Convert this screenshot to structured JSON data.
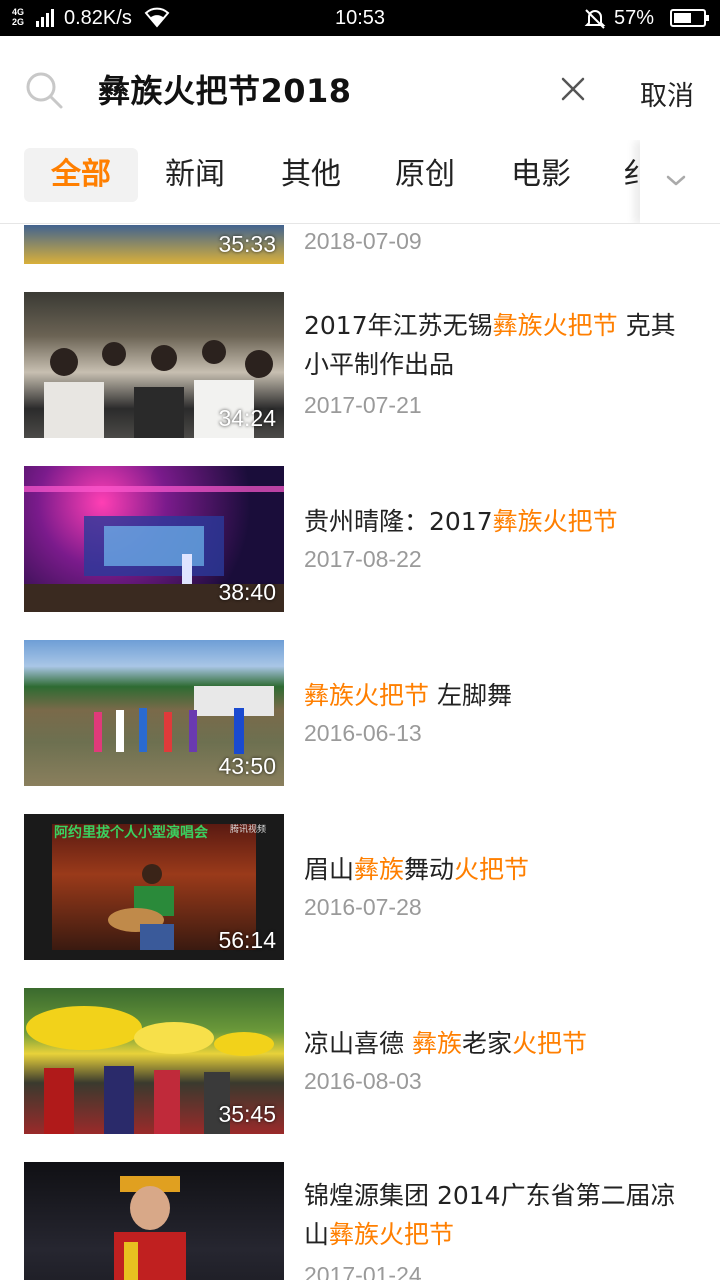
{
  "status_bar": {
    "network": "4G 2G",
    "speed": "0.82K/s",
    "time": "10:53",
    "battery_pct": "57%"
  },
  "search": {
    "query": "彝族火把节2018",
    "cancel_label": "取消"
  },
  "tabs": [
    "全部",
    "新闻",
    "其他",
    "原创",
    "电影",
    "纟"
  ],
  "accent_color": "#ff7f00",
  "results": [
    {
      "title_parts": [],
      "date": "2018-07-09",
      "duration": "35:33"
    },
    {
      "title_parts": [
        "2017年江苏无锡",
        "彝族火把节",
        " 克其小平制作出品"
      ],
      "date": "2017-07-21",
      "duration": "34:24"
    },
    {
      "title_parts": [
        "贵州晴隆：2017",
        "彝族火把节",
        ""
      ],
      "date": "2017-08-22",
      "duration": "38:40"
    },
    {
      "title_parts": [
        "",
        "彝族火把节",
        " 左脚舞"
      ],
      "date": "2016-06-13",
      "duration": "43:50"
    },
    {
      "title_parts": [
        "眉山",
        "彝族",
        "舞动",
        "火把节",
        ""
      ],
      "date": "2016-07-28",
      "duration": "56:14"
    },
    {
      "title_parts": [
        "凉山喜德 ",
        "彝族",
        "老家",
        "火把节",
        ""
      ],
      "date": "2016-08-03",
      "duration": "35:45"
    },
    {
      "title_parts": [
        "锦煌源集团 2014广东省第二届凉山",
        "彝族火把节",
        ""
      ],
      "date": "2017-01-24",
      "duration": ""
    }
  ],
  "thumb_overlay_texts": {
    "thumb4_banner": "阿约里拔个人小型演唱会",
    "thumb4_watermark": "腾讯视频"
  }
}
